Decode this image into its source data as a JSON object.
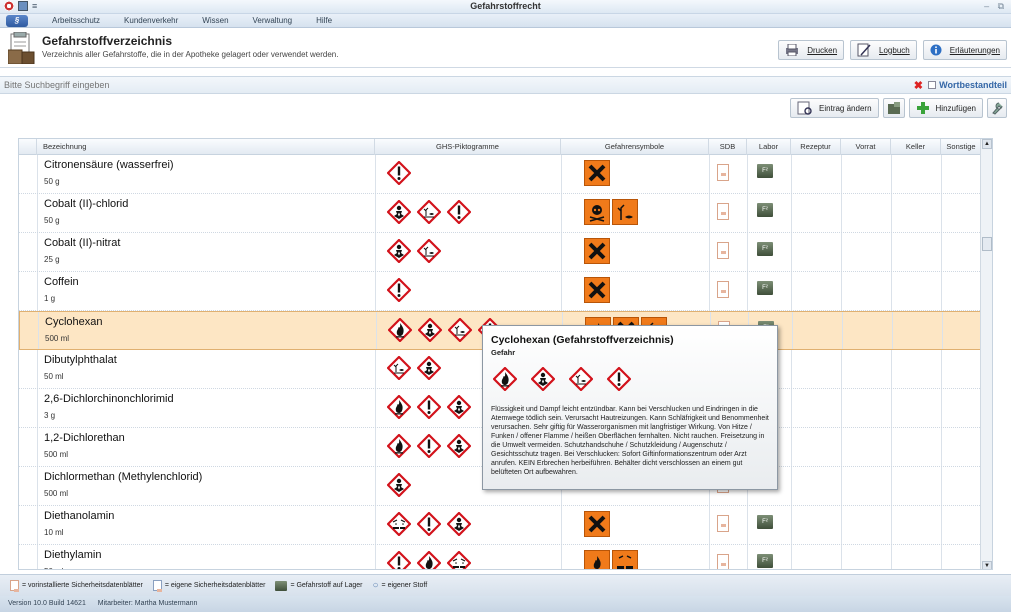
{
  "app": {
    "title": "Gefahrstoffrecht"
  },
  "ribbon": {
    "orb": "§",
    "tabs": [
      "Arbeitsschutz",
      "Kundenverkehr",
      "Wissen",
      "Verwaltung",
      "Hilfe"
    ]
  },
  "header": {
    "title": "Gefahrstoffverzeichnis",
    "subtitle": "Verzeichnis aller Gefahrstoffe, die in der Apotheke gelagert oder verwendet werden.",
    "buttons": {
      "print": "Drucken",
      "log": "Logbuch",
      "explain": "Erläuterungen"
    }
  },
  "search": {
    "placeholder": "Bitte Suchbegriff eingeben",
    "word_component": "Wortbestandteil"
  },
  "toolbar": {
    "edit": "Eintrag ändern",
    "add": "Hinzufügen"
  },
  "columns": [
    "Bezeichnung",
    "GHS-Piktogramme",
    "Gefahrensymbole",
    "SDB",
    "Labor",
    "Rezeptur",
    "Vorrat",
    "Keller",
    "Sonstige"
  ],
  "rows": [
    {
      "name": "Citronensäure (wasserfrei)",
      "amount": "50 g",
      "ghs": [
        "exclamation"
      ],
      "sym": [
        "x"
      ]
    },
    {
      "name": "Cobalt (II)-chlorid",
      "amount": "50 g",
      "ghs": [
        "health",
        "env",
        "exclamation"
      ],
      "sym": [
        "skull",
        "env"
      ]
    },
    {
      "name": "Cobalt (II)-nitrat",
      "amount": "25 g",
      "ghs": [
        "health",
        "env"
      ],
      "sym": [
        "x"
      ]
    },
    {
      "name": "Coffein",
      "amount": "1 g",
      "ghs": [
        "exclamation"
      ],
      "sym": [
        "x"
      ]
    },
    {
      "name": "Cyclohexan",
      "amount": "500 ml",
      "ghs": [
        "flame",
        "health",
        "env",
        "exclamation"
      ],
      "sym": [
        "flame",
        "x",
        "env"
      ]
    },
    {
      "name": "Dibutylphthalat",
      "amount": "50 ml",
      "ghs": [
        "env",
        "health"
      ],
      "sym": []
    },
    {
      "name": "2,6-Dichlorchinonchlorimid",
      "amount": "3 g",
      "ghs": [
        "flame",
        "exclamation",
        "health"
      ],
      "sym": []
    },
    {
      "name": "1,2-Dichlorethan",
      "amount": "500 ml",
      "ghs": [
        "flame",
        "exclamation",
        "health"
      ],
      "sym": []
    },
    {
      "name": "Dichlormethan (Methylenchlorid)",
      "amount": "500 ml",
      "ghs": [
        "health"
      ],
      "sym": []
    },
    {
      "name": "Diethanolamin",
      "amount": "10 ml",
      "ghs": [
        "corrosive",
        "exclamation",
        "health"
      ],
      "sym": [
        "x"
      ]
    },
    {
      "name": "Diethylamin",
      "amount": "50 ml",
      "ghs": [
        "exclamation",
        "flame",
        "corrosive"
      ],
      "sym": [
        "flame",
        "corrosive"
      ]
    }
  ],
  "tooltip": {
    "title": "Cyclohexan (Gefahrstoffverzeichnis)",
    "signal": "Gefahr",
    "text": "Flüssigkeit und Dampf leicht entzündbar. Kann bei Verschlucken und Eindringen in die Atemwege tödlich sein. Verursacht Hautreizungen. Kann Schläfrigkeit und Benommenheit verursachen. Sehr giftig für Wasserorganismen mit langfristiger Wirkung. Von Hitze / Funken / offener Flamme / heißen Oberflächen fernhalten. Nicht rauchen. Freisetzung in die Umwelt vermeiden. Schutzhandschuhe / Schutzkleidung / Augenschutz / Gesichtsschutz tragen. Bei Verschlucken: Sofort Giftinformationszentrum oder Arzt anrufen. KEIN Erbrechen herbeiführen. Behälter dicht verschlossen an einem gut belüfteten Ort aufbewahren."
  },
  "legend": {
    "preinstalled": "= vorinstallierte Sicherheitsdatenblätter",
    "own": "= eigene Sicherheitsdatenblätter",
    "stock": "= Gefahrstoff auf Lager",
    "own_substance": "= eigener Stoff"
  },
  "status": {
    "version": "Version 10.0 Build 14621",
    "user": "Mitarbeiter: Martha Mustermann"
  }
}
